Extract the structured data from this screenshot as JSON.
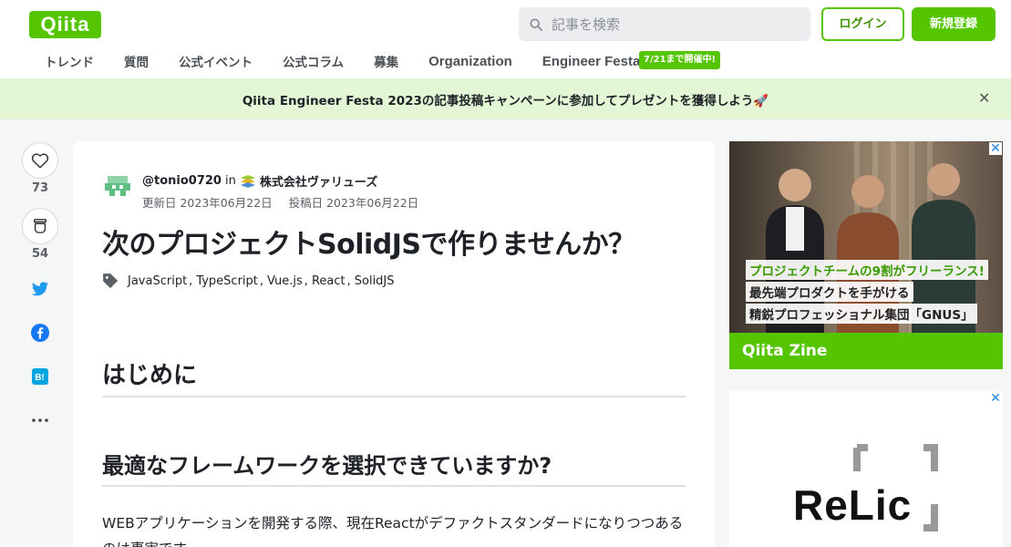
{
  "header": {
    "logo": "Qiita",
    "search": {
      "placeholder": "記事を検索"
    },
    "login_label": "ログイン",
    "signup_label": "新規登録"
  },
  "nav": {
    "items": [
      "トレンド",
      "質問",
      "公式イベント",
      "公式コラム",
      "募集",
      "Organization",
      "Engineer Festa"
    ],
    "badge": "7/21まで開催中!"
  },
  "banner": {
    "text": "Qiita Engineer Festa 2023の記事投稿キャンペーンに参加してプレゼントを獲得しよう🚀"
  },
  "sidebar": {
    "like_count": "73",
    "stock_count": "54"
  },
  "article": {
    "author": "@tonio0720",
    "in_word": "in",
    "organization": "株式会社ヴァリューズ",
    "updated": "更新日 2023年06月22日",
    "posted": "投稿日 2023年06月22日",
    "title": "次のプロジェクトSolidJSで作りませんか？",
    "tags": [
      "JavaScript",
      "TypeScript",
      "Vue.js",
      "React",
      "SolidJS"
    ],
    "heading1": "はじめに",
    "heading2": "最適なフレームワークを選択できていますか?",
    "paragraph": "WEBアプリケーションを開発する際、現在Reactがデファクトスタンダードになりつつあるのは事実です。"
  },
  "ads": {
    "ad1_line1": "プロジェクトチームの9割がフリーランス!",
    "ad1_line2": "最先端プロダクトを手がける",
    "ad1_line3": "精鋭プロフェッショナル集団「GNUS」",
    "ad1_brand": "Qiita Zine",
    "ad2_brand": "ReLic"
  },
  "colors": {
    "brand": "#55c500",
    "banner_bg": "#e3f7d6"
  }
}
